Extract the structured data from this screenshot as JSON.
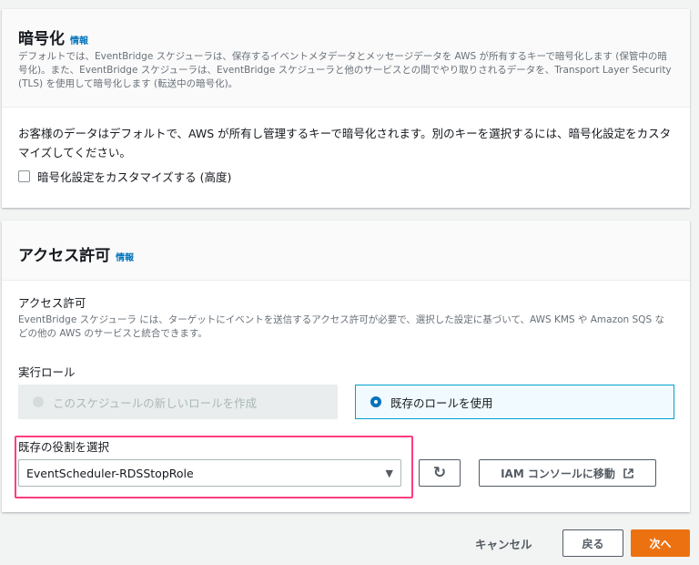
{
  "encryption": {
    "title": "暗号化",
    "info": "情報",
    "description": "デフォルトでは、EventBridge スケジューラは、保存するイベントメタデータとメッセージデータを AWS が所有するキーで暗号化します (保管中の暗号化)。また、EventBridge スケジューラは、EventBridge スケジューラと他のサービスとの間でやり取りされるデータを、Transport Layer Security (TLS) を使用して暗号化します (転送中の暗号化)。",
    "body": "お客様のデータはデフォルトで、AWS が所有し管理するキーで暗号化されます。別のキーを選択するには、暗号化設定をカスタマイズしてください。",
    "checkbox_label": "暗号化設定をカスタマイズする (高度)",
    "checkbox_checked": false
  },
  "permissions": {
    "title": "アクセス許可",
    "info": "情報",
    "field_label": "アクセス許可",
    "field_description": "EventBridge スケジューラ には、ターゲットにイベントを送信するアクセス許可が必要で、選択した設定に基づいて、AWS KMS や Amazon SQS などの他の AWS のサービスと統合できます。",
    "role_label": "実行ロール",
    "option_new": "このスケジュールの新しいロールを作成",
    "option_existing": "既存のロールを使用",
    "selected_option": "existing",
    "select_label": "既存の役割を選択",
    "select_value": "EventScheduler-RDSStopRole",
    "iam_button": "IAM コンソールに移動"
  },
  "footer": {
    "cancel": "キャンセル",
    "back": "戻る",
    "next": "次へ"
  },
  "colors": {
    "accent": "#0073bb",
    "primary": "#ec7211",
    "highlight": "#ff3d7f"
  }
}
